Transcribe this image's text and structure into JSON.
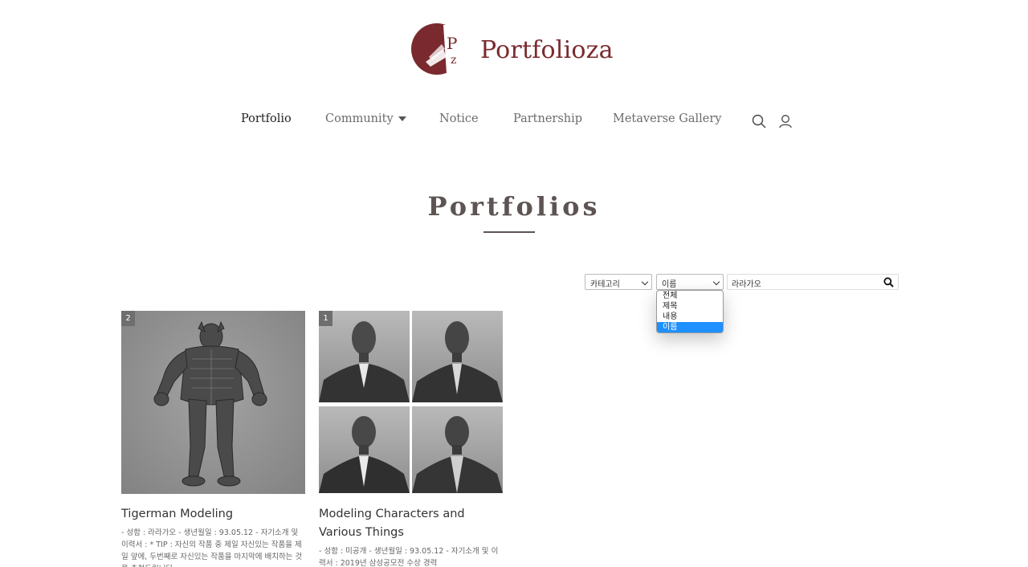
{
  "brand": {
    "name": "Portfolioza",
    "mark_letters": "Pz",
    "color": "#7a2a2e"
  },
  "nav": {
    "items": [
      {
        "label": "Portfolio",
        "active": true
      },
      {
        "label": "Community",
        "has_dropdown": true
      },
      {
        "label": "Notice"
      },
      {
        "label": "Partnership"
      },
      {
        "label": "Metaverse Gallery"
      }
    ],
    "icons": [
      "search-icon",
      "user-icon"
    ]
  },
  "page": {
    "title": "Portfolios"
  },
  "search": {
    "category_select": "카테고리",
    "field_select": "이름",
    "query": "라라가오",
    "field_options": [
      "전체",
      "제목",
      "내용",
      "이름"
    ],
    "selected_option": "이름",
    "selected_color": "#1e90ff"
  },
  "cards": [
    {
      "badge": "2",
      "title": "Tigerman Modeling",
      "description": "- 성함 : 라라가오 - 생년월일 : 93.05.12 - 자기소개 및 이력서 : * TIP : 자신의 작품 중 제일 자신있는 작품을 제일 앞에, 두번째로 자신있는 작품을 마지막에 배치하는 것을 추천드립니다."
    },
    {
      "badge": "1",
      "title": "Modeling Characters and Various Things",
      "description": "- 성함 : 미공개 - 생년월일 : 93.05.12 - 자기소개 및 이력서 :  2019년 삼성공모전 수상 경력"
    }
  ]
}
